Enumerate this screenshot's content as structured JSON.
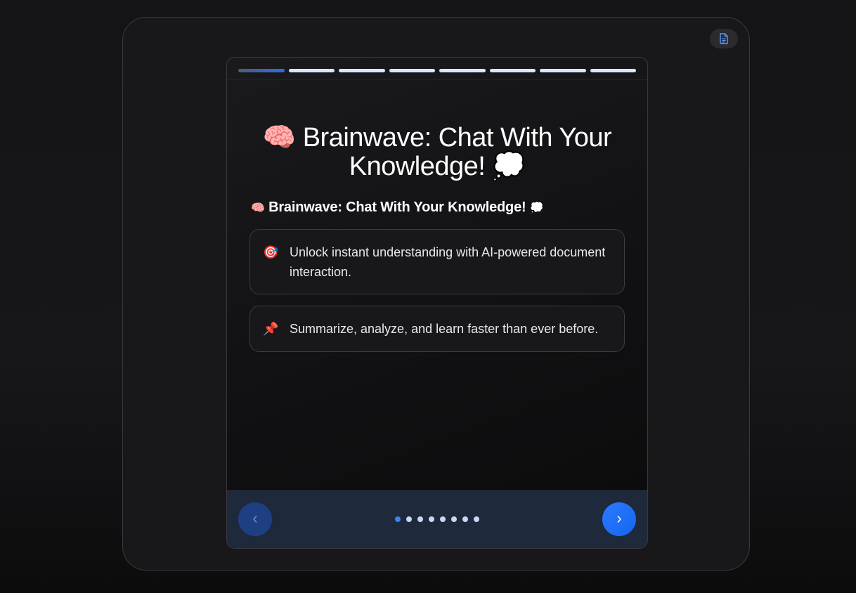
{
  "title": {
    "emoji_start": "🧠",
    "text": "Brainwave: Chat With Your Knowledge!",
    "emoji_end": "💭"
  },
  "subtitle": {
    "emoji_start": "🧠",
    "text": "Brainwave: Chat With Your Knowledge!",
    "emoji_end": "💭"
  },
  "points": [
    {
      "icon": "🎯",
      "text": "Unlock instant understanding with AI-powered document interaction."
    },
    {
      "icon": "📌",
      "text": "Summarize, analyze, and learn faster than ever before."
    }
  ],
  "progress": {
    "total_slides": 8,
    "current_slide": 1
  },
  "nav": {
    "prev_icon": "‹",
    "next_icon": "›"
  },
  "colors": {
    "accent": "#2a7bff",
    "footer_bg": "#1e293b",
    "dot_active": "#3b82f6",
    "dot_inactive": "#c8d8f5",
    "progress_inactive": "#dbe6ff"
  }
}
